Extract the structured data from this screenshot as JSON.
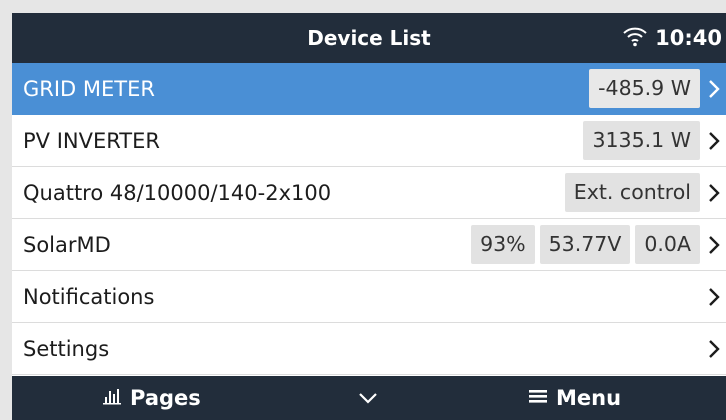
{
  "header": {
    "title": "Device List",
    "time": "10:40",
    "icons": {
      "wifi": "wifi-icon"
    }
  },
  "devices": [
    {
      "label": "GRID METER",
      "values": [
        "-485.9 W"
      ],
      "selected": true
    },
    {
      "label": "PV INVERTER",
      "values": [
        "3135.1 W"
      ]
    },
    {
      "label": "Quattro 48/10000/140-2x100",
      "values": [
        "Ext. control"
      ]
    },
    {
      "label": "SolarMD",
      "values": [
        "93%",
        "53.77V",
        "0.0A"
      ]
    },
    {
      "label": "Notifications",
      "values": []
    },
    {
      "label": "Settings",
      "values": []
    }
  ],
  "footer": {
    "pages_label": "Pages",
    "menu_label": "Menu",
    "icons": {
      "pages": "bar-chart-icon",
      "toggle": "chevron-down-icon",
      "menu": "hamburger-menu-icon"
    }
  },
  "colors": {
    "bar_bg": "#222d3b",
    "selected_row": "#4a8fd5",
    "value_pill": "#e2e2e2"
  }
}
